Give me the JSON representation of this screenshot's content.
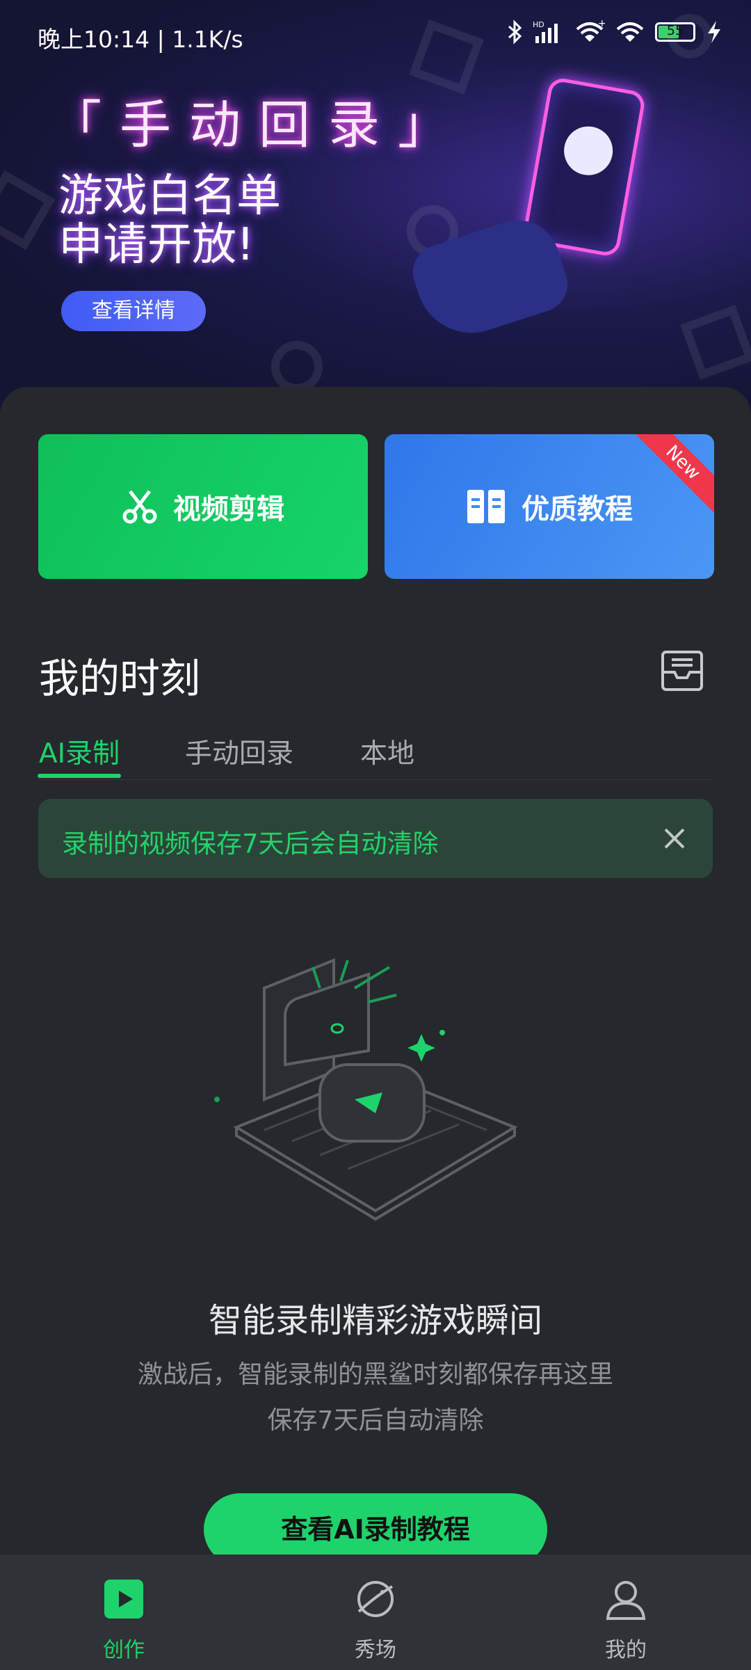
{
  "status_bar": {
    "time_speed": "晚上10:14 | 1.1K/s",
    "battery": "55",
    "icons": [
      "bluetooth-icon",
      "hd-signal-icon",
      "wifi-icon",
      "wifi-icon",
      "battery-icon",
      "charging-icon"
    ]
  },
  "banner": {
    "title": "「手动回录」",
    "line1": "游戏白名单",
    "line2": "申请开放!",
    "button": "查看详情"
  },
  "cards": {
    "video_edit": "视频剪辑",
    "tutorials": "优质教程",
    "badge": "New",
    "colors": {
      "green": "#16d46a",
      "blue": "#3d8bf0",
      "badge": "#f0364a"
    }
  },
  "section": {
    "title": "我的时刻"
  },
  "tabs": [
    {
      "label": "AI录制",
      "active": true
    },
    {
      "label": "手动回录",
      "active": false
    },
    {
      "label": "本地",
      "active": false
    }
  ],
  "notice": {
    "text": "录制的视频保存7天后会自动清除"
  },
  "empty_state": {
    "title": "智能录制精彩游戏瞬间",
    "desc1": "激战后，智能录制的黑鲨时刻都保存再这里",
    "desc2": "保存7天后自动清除",
    "button": "查看AI录制教程"
  },
  "bottom_nav": [
    {
      "label": "创作",
      "icon": "play-square-icon",
      "active": true
    },
    {
      "label": "秀场",
      "icon": "planet-icon",
      "active": false
    },
    {
      "label": "我的",
      "icon": "user-icon",
      "active": false
    }
  ],
  "accent": "#1ed36b"
}
